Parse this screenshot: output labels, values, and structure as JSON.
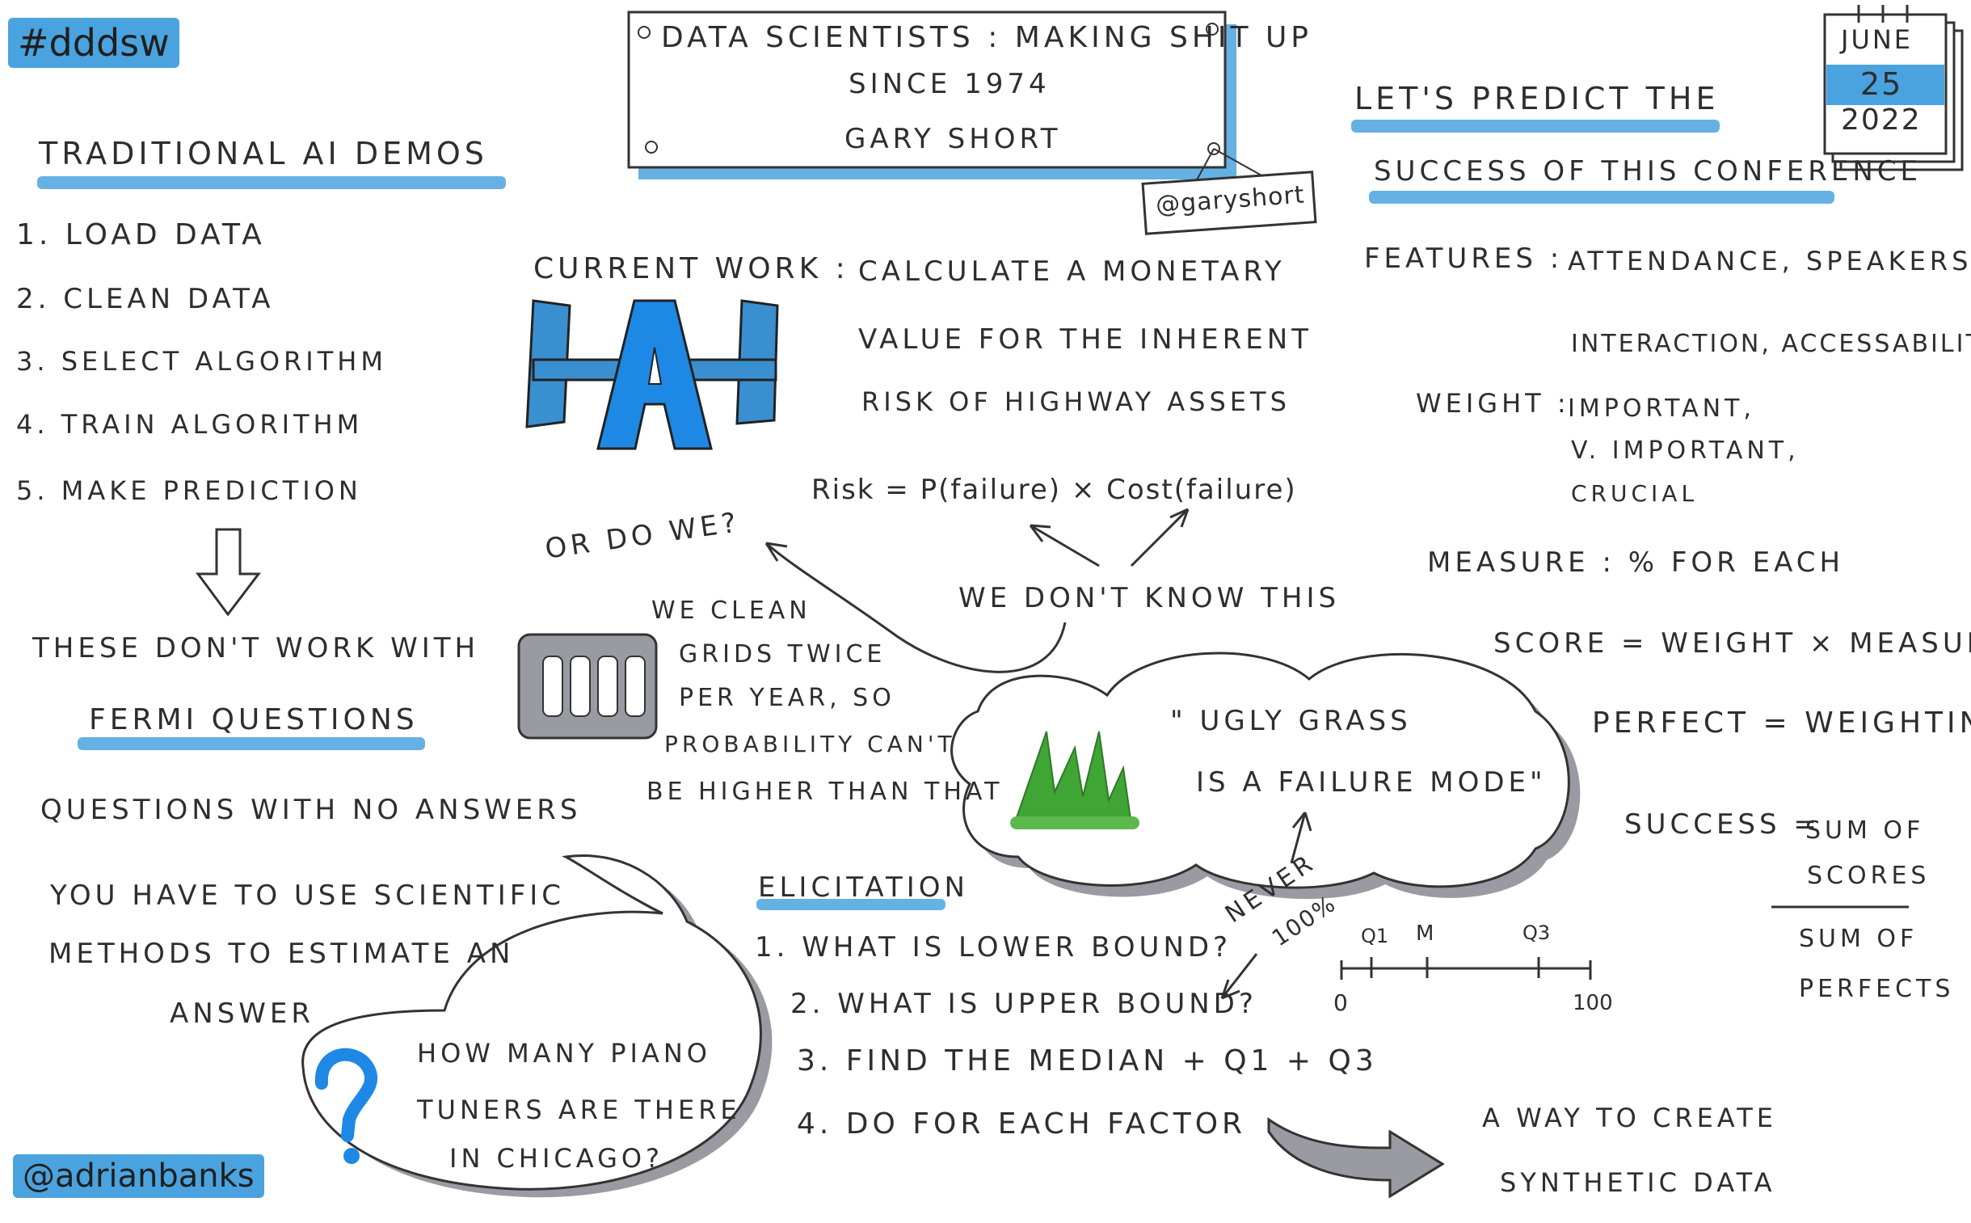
{
  "hashtag": "#dddsw",
  "author_handle": "@adrianbanks",
  "title_box": {
    "line1": "Data Scientists : Making Shit Up",
    "line2": "Since 1974",
    "speaker": "Gary Short",
    "speaker_handle": "@garyshort"
  },
  "date": {
    "month": "June",
    "day": "25",
    "year": "2022"
  },
  "traditional": {
    "heading": "Traditional AI Demos",
    "steps": [
      "1. Load Data",
      "2. Clean Data",
      "3. Select Algorithm",
      "4. Train Algorithm",
      "5. Make Prediction"
    ],
    "not_work": "These don't work with",
    "fermi": "Fermi Questions",
    "def": "Questions with no answers",
    "method": [
      "You have to use scientific",
      "methods to estimate an",
      "answer"
    ],
    "bubble": [
      "How many piano",
      "tuners are there",
      "in Chicago?"
    ]
  },
  "current_work": {
    "label": "Current Work :",
    "lines": [
      "Calculate a monetary",
      "value for the inherent",
      "risk of highway assets"
    ],
    "formula": "Risk = P(failure) × Cost(failure)",
    "dont_know": "We don't know this",
    "or_do_we": "Or do we?",
    "clean": [
      "We clean",
      "grids twice",
      "per year, so",
      "probability can't",
      "be higher than that"
    ],
    "cloud": [
      "\" Ugly grass",
      "is a failure mode\""
    ],
    "never": "Never",
    "pct": "100%"
  },
  "elicitation": {
    "heading": "Elicitation",
    "steps": [
      "1. What is lower bound?",
      "2. What is upper bound?",
      "3. Find the median + Q1 + Q3",
      "4. Do for each factor"
    ],
    "scale": {
      "q1": "Q1",
      "m": "M",
      "q3": "Q3",
      "min": "0",
      "max": "100"
    },
    "synthetic": [
      "A way to create",
      "synthetic data"
    ]
  },
  "predict": {
    "heading1": "Let's predict the",
    "heading2": "success of this conference",
    "features_label": "Features :",
    "features": [
      "Attendance, speakers",
      "Interaction, Accessability"
    ],
    "weight_label": "Weight :",
    "weights": [
      "Important,",
      "V. Important,",
      "Crucial"
    ],
    "measure": "Measure : % for each",
    "score": "Score = weight × measure",
    "perfect": "Perfect = weighting",
    "success_label": "Success =",
    "numerator": [
      "Sum of",
      "scores"
    ],
    "denominator": [
      "Sum of",
      "perfects"
    ]
  },
  "colors": {
    "accent": "#4aa3df",
    "ink": "#2e2e2e",
    "grass": "#3fa535"
  }
}
